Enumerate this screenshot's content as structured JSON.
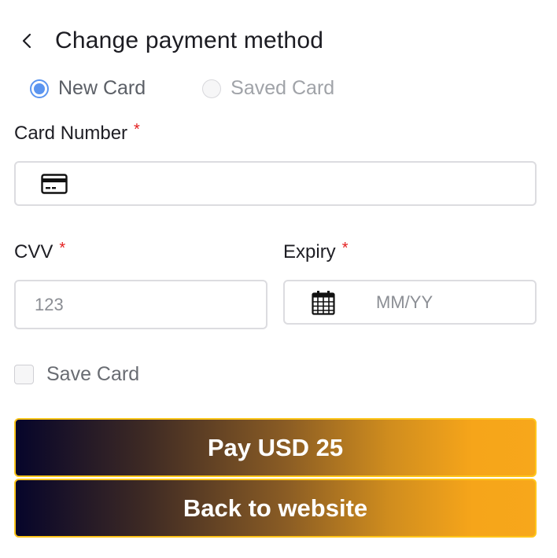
{
  "header": {
    "title": "Change payment method",
    "back_icon": "chevron-left-icon"
  },
  "payment_type": {
    "options": [
      {
        "label": "New Card",
        "selected": true
      },
      {
        "label": "Saved Card",
        "selected": false
      }
    ],
    "selected_color": "#5b95f0"
  },
  "card_number": {
    "label": "Card Number",
    "required_mark": "*",
    "value": "",
    "placeholder": "",
    "icon": "credit-card-icon"
  },
  "cvv": {
    "label": "CVV",
    "required_mark": "*",
    "value": "",
    "placeholder": "123"
  },
  "expiry": {
    "label": "Expiry",
    "required_mark": "*",
    "value": "",
    "placeholder": "MM/YY",
    "icon": "calendar-icon"
  },
  "save_card": {
    "label": "Save Card",
    "checked": false
  },
  "buttons": {
    "pay": "Pay USD 25",
    "back": "Back to website"
  },
  "colors": {
    "required": "#e41e1e",
    "button_border": "#ffc51a",
    "gradient_start": "#06052a",
    "gradient_end": "#f7a71b"
  }
}
